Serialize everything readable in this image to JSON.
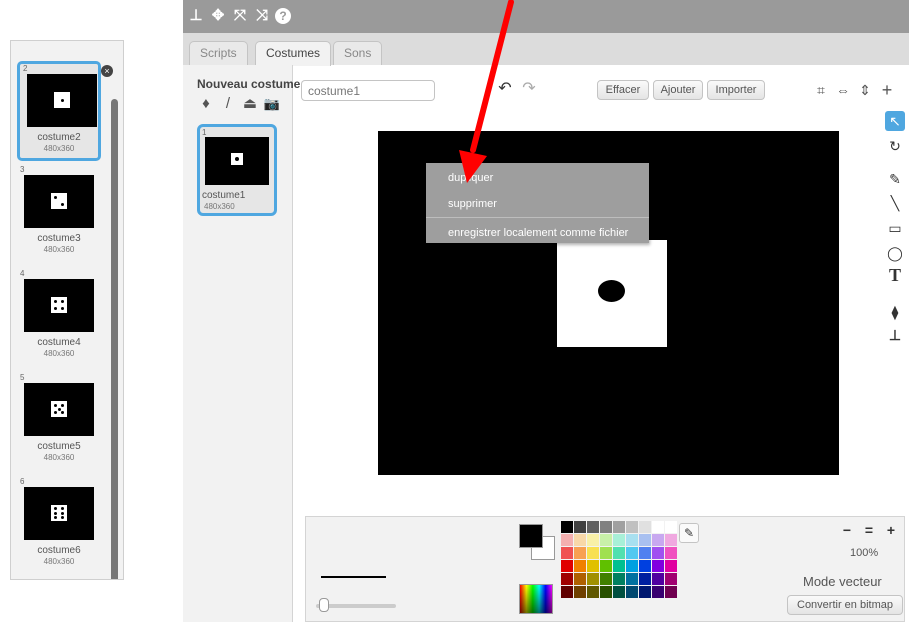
{
  "left_list": {
    "items": [
      {
        "num": "2",
        "name": "costume2",
        "size": "480x360",
        "dots": 1
      },
      {
        "num": "3",
        "name": "costume3",
        "size": "480x360",
        "dots": 2
      },
      {
        "num": "4",
        "name": "costume4",
        "size": "480x360",
        "dots": 4
      },
      {
        "num": "5",
        "name": "costume5",
        "size": "480x360",
        "dots": 5
      },
      {
        "num": "6",
        "name": "costume6",
        "size": "480x360",
        "dots": 6
      }
    ],
    "close_glyph": "×"
  },
  "topbar": {
    "icons": [
      "stamp-icon",
      "move-icon",
      "grow-icon",
      "shrink-icon",
      "help-icon"
    ],
    "glyphs": [
      "⊥",
      "✥",
      "⤧",
      "⤨",
      "?"
    ]
  },
  "tabs": [
    {
      "label": "Scripts"
    },
    {
      "label": "Costumes"
    },
    {
      "label": "Sons"
    }
  ],
  "costume_panel": {
    "title": "Nouveau costume:",
    "new_icons": [
      "♦",
      "/",
      "⏏",
      "📷"
    ],
    "card": {
      "num": "1",
      "name": "costume1",
      "size": "480x360"
    }
  },
  "editor": {
    "name_value": "costume1",
    "undo": "↶",
    "redo": "↷",
    "buttons": {
      "clear": "Effacer",
      "add": "Ajouter",
      "import": "Importer"
    },
    "top_tools": [
      "⌗",
      "⇔",
      "⇕",
      "+"
    ],
    "right_tools": [
      "↖",
      "↻",
      "✎",
      "╲",
      "▭",
      "◯",
      "T",
      "⧫",
      "⊥"
    ]
  },
  "context_menu": {
    "items": [
      "dupliquer",
      "supprimer",
      "enregistrer localement comme fichier"
    ]
  },
  "bottom": {
    "zoom_out": "−",
    "zoom_reset": "=",
    "zoom_in": "+",
    "zoom_level": "100%",
    "mode": "Mode vecteur",
    "convert_button": "Convertir en bitmap",
    "pipette": "✎"
  },
  "colors": {
    "accent_selected": "#4fa7e0",
    "arrow": "#ff0000",
    "palette": [
      "#000000",
      "#404040",
      "#606060",
      "#808080",
      "#a0a0a0",
      "#c0c0c0",
      "#e0e0e0",
      "#ffffff",
      "#ffffff",
      "#f4b0b0",
      "#f8d8a8",
      "#f8f0a8",
      "#c8f0a8",
      "#a8f0d8",
      "#a8e0f0",
      "#a8c0f0",
      "#c8a8f0",
      "#f0a8e0",
      "#f05050",
      "#f8a050",
      "#f8e050",
      "#a0e050",
      "#50e0b0",
      "#50c8f0",
      "#5080f0",
      "#a050f0",
      "#f050c0",
      "#e00000",
      "#f08000",
      "#e0c000",
      "#60c000",
      "#00c090",
      "#00a0e0",
      "#0040e0",
      "#8000e0",
      "#e000a0",
      "#a00000",
      "#b06000",
      "#a09000",
      "#408000",
      "#008060",
      "#0070a0",
      "#0020a0",
      "#5000a0",
      "#a00070",
      "#600000",
      "#704000",
      "#605800",
      "#285000",
      "#005040",
      "#004870",
      "#001870",
      "#380070",
      "#700050"
    ]
  }
}
